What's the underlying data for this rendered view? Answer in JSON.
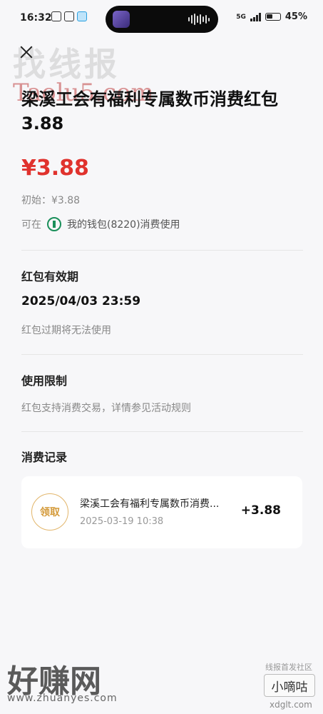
{
  "status_bar": {
    "time": "16:32",
    "network": "5G",
    "battery": "45%"
  },
  "watermarks": {
    "top_cn": "找线报",
    "top_en": "Taolu5.com",
    "bottom_cn": "好赚网",
    "bottom_url": "www.zhuanyes.com",
    "br_caption": "线报首发社区",
    "br_box": "小嘀咕",
    "br_url": "xdglt.com"
  },
  "page": {
    "title": "梁溪工会有福利专属数币消费红包3.88",
    "amount": "¥3.88",
    "initial": "初始：¥3.88",
    "wallet_prefix": "可在",
    "wallet_text": "我的钱包(8220)消费使用"
  },
  "validity": {
    "title": "红包有效期",
    "date": "2025/04/03 23:59",
    "desc": "红包过期将无法使用"
  },
  "restriction": {
    "title": "使用限制",
    "desc": "红包支持消费交易，详情参见活动规则"
  },
  "records": {
    "title": "消费记录",
    "items": [
      {
        "badge": "领取",
        "name": "梁溪工会有福利专属数币消费...",
        "time": "2025-03-19 10:38",
        "amount": "+3.88"
      }
    ]
  },
  "colors": {
    "accent_red": "#e0322d",
    "badge_gold": "#d49a3a",
    "bank_green": "#1a8f5a"
  }
}
